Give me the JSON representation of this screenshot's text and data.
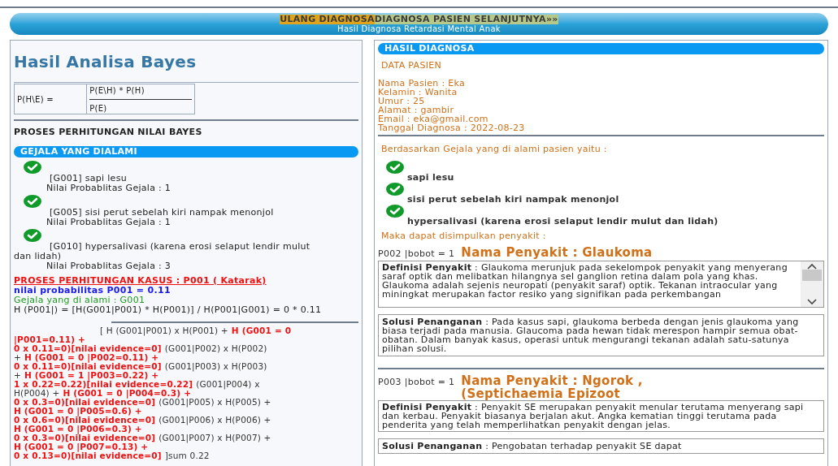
{
  "header": {
    "links": [
      {
        "label": "ULANG DIAGNOSA",
        "kind": "retry"
      },
      {
        "label": "DIAGNOSA PASIEN SELANJUTNYA»»",
        "kind": "next"
      }
    ],
    "subtitle": "Hasil Diagnosa Retardasi Mental Anak"
  },
  "left": {
    "title": "Hasil Analisa Bayes",
    "formula": {
      "lhs": "P(H\\E) =",
      "numerator": "P(E\\H) * P(H)",
      "denominator": "P(E)"
    },
    "section_title": "PROSES PERHITUNGAN NILAI BAYES",
    "symptoms_title": "GEJALA YANG DIALAMI",
    "symptoms": [
      {
        "label": "[G001] sapi lesu",
        "value": "Nilai Probablitas Gejala : 1",
        "checked": true
      },
      {
        "label": "[G005] sisi perut sebelah kiri nampak menonjol",
        "value": "Nilai Probablitas Gejala : 1",
        "checked": true
      },
      {
        "label": "[G010] hypersalivasi (karena erosi selaput lendir mulut dan lidah)",
        "value": "Nilai Probablitas Gejala : 3",
        "checked": true
      }
    ],
    "case_title": "PROSES PERHITUNGAN KASUS : P001 ( Katarak)",
    "probability": "nilai probabilitas P001 = 0.11",
    "experienced": "Gejala yang di alami : G001",
    "equation": "H (P001|) = [H(G001|P001) * H(P001)] / H(P001|G001) = 0 * 0.11",
    "term_lines": [
      [
        {
          "text": "[ H (G001|P001) x H(P001) +",
          "kind": "plain"
        },
        {
          "text": "H (G001 = 0",
          "kind": "highlight"
        }
      ],
      [
        {
          "text": "|P001=0.11) +",
          "kind": "highlight"
        }
      ],
      [
        {
          "text": "0 x 0.11=0)[nilai evidence=0]",
          "kind": "highlight"
        },
        {
          "text": "(G001|P002) x H(P002)",
          "kind": "plain"
        }
      ],
      [
        {
          "text": "+",
          "kind": "plain"
        },
        {
          "text": "H (G001 = 0 |P002=0.11) +",
          "kind": "highlight"
        }
      ],
      [
        {
          "text": "0 x 0.11=0)[nilai evidence=0]",
          "kind": "highlight"
        },
        {
          "text": "(G001|P003) x H(P003)",
          "kind": "plain"
        }
      ],
      [
        {
          "text": "+",
          "kind": "plain"
        },
        {
          "text": "H (G001 = 1 |P003=0.22) +",
          "kind": "highlight"
        }
      ],
      [
        {
          "text": "1 x 0.22=0.22)[nilai evidence=0.22]",
          "kind": "highlight"
        },
        {
          "text": "(G001|P004) x",
          "kind": "plain"
        }
      ],
      [
        {
          "text": "H(P004) +",
          "kind": "plain"
        },
        {
          "text": "H (G001 = 0 |P004=0.3) +",
          "kind": "highlight"
        }
      ],
      [
        {
          "text": "0 x 0.3=0)[nilai evidence=0]",
          "kind": "highlight"
        },
        {
          "text": "(G001|P005) x H(P005) +",
          "kind": "plain"
        }
      ],
      [
        {
          "text": "H (G001 = 0 |P005=0.6) +",
          "kind": "highlight"
        }
      ],
      [
        {
          "text": "0 x 0.6=0)[nilai evidence=0]",
          "kind": "highlight"
        },
        {
          "text": "(G001|P006) x H(P006) +",
          "kind": "plain"
        }
      ],
      [
        {
          "text": "H (G001 = 0 |P006=0.3) +",
          "kind": "highlight"
        }
      ],
      [
        {
          "text": "0 x 0.3=0)[nilai evidence=0]",
          "kind": "highlight"
        },
        {
          "text": "(G001|P007) x H(P007) +",
          "kind": "plain"
        }
      ],
      [
        {
          "text": "H (G001 = 0 |P007=0.13) +",
          "kind": "highlight"
        }
      ],
      [
        {
          "text": "0 x 0.13=0)[nilai evidence=0]",
          "kind": "highlight"
        },
        {
          "text": "]sum 0.22",
          "kind": "plain"
        }
      ]
    ]
  },
  "right": {
    "title": "HASIL DIAGNOSA",
    "patient_title": "DATA PASIEN",
    "patient": [
      "Nama Pasien : Eka",
      "Kelamin : Wanita",
      "Umur : 25",
      "Alamat : gambir",
      "Email : eka@gmail.com",
      "Tanggal Diagnosa : 2022-08-23"
    ],
    "intro": "Berdasarkan Gejala yang di alami pasien yaitu :",
    "symptoms": [
      {
        "label": "sapi lesu",
        "checked": true
      },
      {
        "label": "sisi perut sebelah kiri nampak menonjol",
        "checked": true
      },
      {
        "label": "hypersalivasi (karena erosi selaput lendir mulut dan lidah)",
        "checked": true
      }
    ],
    "conclusion": "Maka dapat disimpulkan penyakit :",
    "diseases": [
      {
        "code": "P002 |bobot = 1",
        "name": "Nama Penyakit : Glaukoma",
        "definition_label": "Definisi Penyakit",
        "definition": ": Glaukoma merunjuk pada sekelompok penyakit yang menyerang saraf optik dan melibatkan hilangnya sel ganglion retina dalam pola yang khas. Glaukoma adalah sejenis neuropati (penyakit saraf) optik. Tekanan intraocular yang miningkat merupakan factor resiko yang signifikan pada perkembangan",
        "definition_scroll": true,
        "solution_label": "Solusi Penanganan",
        "solution": ": Pada kasus sapi, glaukoma berbeda dengan jenis glaukoma yang biasa terjadi pada manusia. Glaucoma pada hewan tidak merespon hampir semua obat-obatan. Dalam banyak kasus, operasi untuk mengurangi tekanan adalah satu-satunya pilihan solusi."
      },
      {
        "code": "P003 |bobot = 1",
        "name": "Nama Penyakit : Ngorok , (Septichaemia Epizoot",
        "definition_label": "Definisi Penyakit",
        "definition": ": Penyakit SE merupakan penyakit menular terutama menyerang sapi dan kerbau. Penyakit biasanya berjalan akut. Angka kematian tinggi terutama pada penderita yang telah memperlihatkan penyakit dengan jelas.",
        "definition_scroll": false,
        "solution_label": "Solusi Penanganan",
        "solution": ": Pengobatan terhadap penyakit SE dapat"
      }
    ]
  }
}
